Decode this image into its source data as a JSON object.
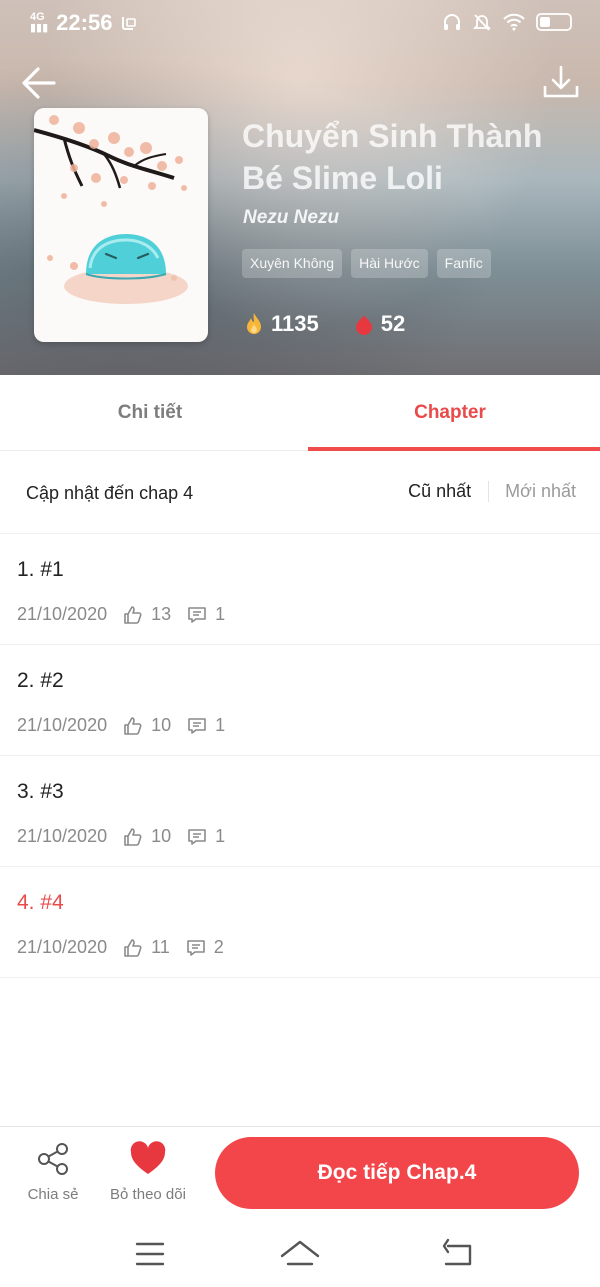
{
  "status_bar": {
    "network": "4G",
    "time": "22:56"
  },
  "book": {
    "title": "Chuyển Sinh Thành Bé Slime Loli",
    "author": "Nezu Nezu",
    "tags": [
      "Xuyên Không",
      "Hài Hước",
      "Fanfic"
    ],
    "views": "1135",
    "likes": "52"
  },
  "tabs": [
    {
      "label": "Chi tiết",
      "active": false
    },
    {
      "label": "Chapter",
      "active": true
    }
  ],
  "chapter_list": {
    "update_text": "Cập nhật đến chap 4",
    "sort_oldest": "Cũ nhất",
    "sort_newest": "Mới nhất",
    "items": [
      {
        "title": "1. #1",
        "date": "21/10/2020",
        "likes": "13",
        "comments": "1",
        "current": false
      },
      {
        "title": "2. #2",
        "date": "21/10/2020",
        "likes": "10",
        "comments": "1",
        "current": false
      },
      {
        "title": "3. #3",
        "date": "21/10/2020",
        "likes": "10",
        "comments": "1",
        "current": false
      },
      {
        "title": "4. #4",
        "date": "21/10/2020",
        "likes": "11",
        "comments": "2",
        "current": true
      }
    ]
  },
  "actions": {
    "share_label": "Chia sẻ",
    "follow_label": "Bỏ theo dõi",
    "read_label": "Đọc tiếp Chap.4"
  },
  "colors": {
    "accent": "#f2464b",
    "heart": "#e8383f"
  },
  "icons": [
    "back-arrow-icon",
    "download-icon",
    "fire-icon",
    "heart-drop-icon",
    "thumbs-up-icon",
    "comment-icon",
    "share-icon",
    "heart-icon",
    "menu-icon",
    "home-icon",
    "return-icon"
  ]
}
